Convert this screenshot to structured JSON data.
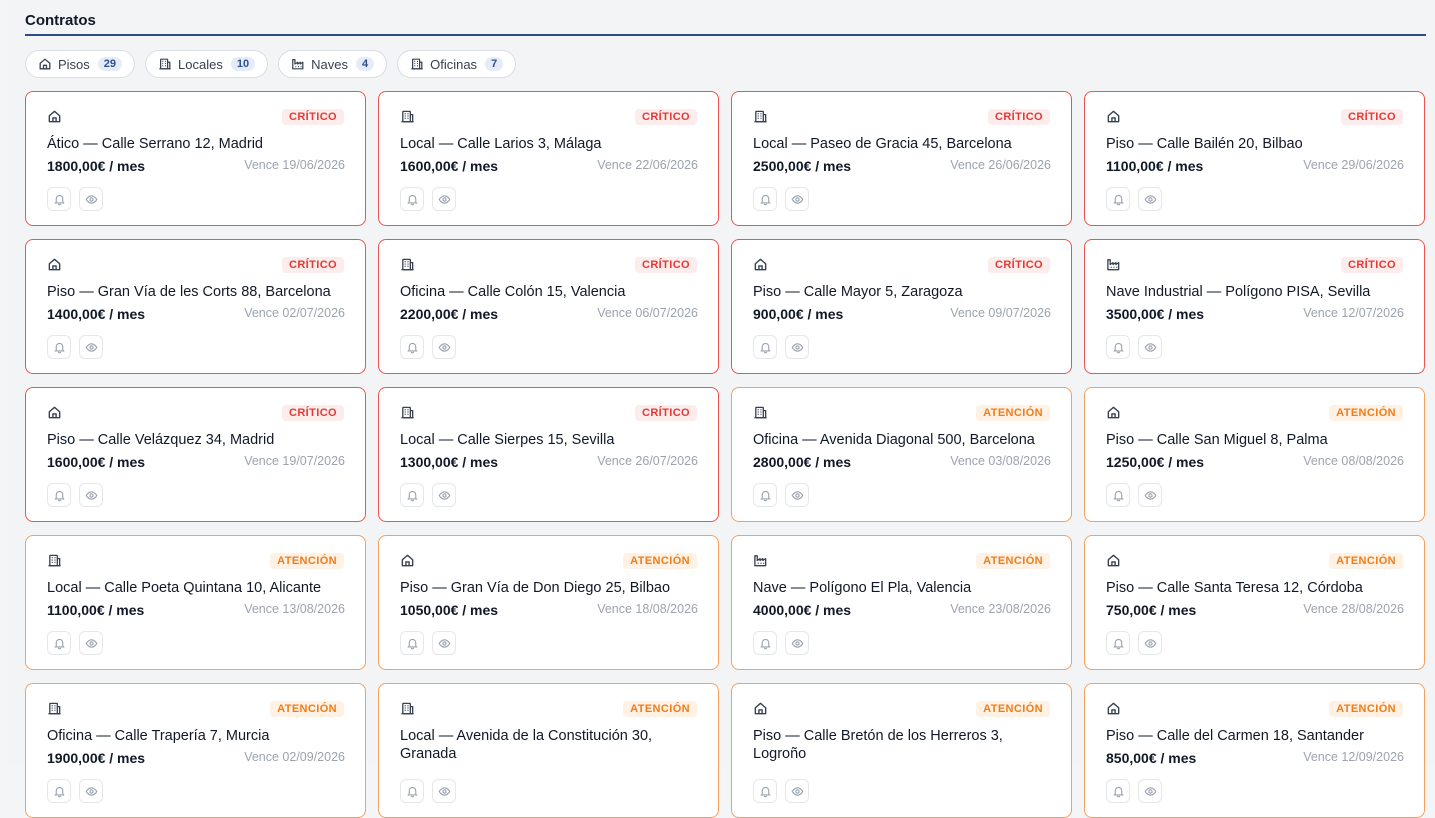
{
  "section": {
    "title": "Contratos"
  },
  "tabs": [
    {
      "icon": "house-icon",
      "label": "Pisos",
      "count": "29"
    },
    {
      "icon": "building-icon",
      "label": "Locales",
      "count": "10"
    },
    {
      "icon": "factory-icon",
      "label": "Naves",
      "count": "4"
    },
    {
      "icon": "building-icon",
      "label": "Oficinas",
      "count": "7"
    }
  ],
  "colors": {
    "critical": "#e53935",
    "attention": "#ef7d1a",
    "accent": "#2f4a8a"
  },
  "cards": [
    {
      "icon": "house-icon",
      "status": "critical",
      "badge": "CRÍTICO",
      "title": "Ático — Calle Serrano 12, Madrid",
      "price": "1800,00€ / mes",
      "due": "Vence 19/06/2026"
    },
    {
      "icon": "building-icon",
      "status": "critical",
      "badge": "CRÍTICO",
      "title": "Local — Calle Larios 3, Málaga",
      "price": "1600,00€ / mes",
      "due": "Vence 22/06/2026"
    },
    {
      "icon": "building-icon",
      "status": "critical",
      "badge": "CRÍTICO",
      "title": "Local — Paseo de Gracia 45, Barcelona",
      "price": "2500,00€ / mes",
      "due": "Vence 26/06/2026"
    },
    {
      "icon": "house-icon",
      "status": "critical",
      "badge": "CRÍTICO",
      "title": "Piso — Calle Bailén 20, Bilbao",
      "price": "1100,00€ / mes",
      "due": "Vence 29/06/2026"
    },
    {
      "icon": "house-icon",
      "status": "critical",
      "badge": "CRÍTICO",
      "title": "Piso — Gran Vía de les Corts 88, Barcelona",
      "price": "1400,00€ / mes",
      "due": "Vence 02/07/2026"
    },
    {
      "icon": "building-icon",
      "status": "critical",
      "badge": "CRÍTICO",
      "title": "Oficina — Calle Colón 15, Valencia",
      "price": "2200,00€ / mes",
      "due": "Vence 06/07/2026"
    },
    {
      "icon": "house-icon",
      "status": "critical",
      "badge": "CRÍTICO",
      "title": "Piso — Calle Mayor 5, Zaragoza",
      "price": "900,00€ / mes",
      "due": "Vence 09/07/2026"
    },
    {
      "icon": "factory-icon",
      "status": "critical",
      "badge": "CRÍTICO",
      "title": "Nave Industrial — Polígono PISA, Sevilla",
      "price": "3500,00€ / mes",
      "due": "Vence 12/07/2026"
    },
    {
      "icon": "house-icon",
      "status": "critical",
      "badge": "CRÍTICO",
      "title": "Piso — Calle Velázquez 34, Madrid",
      "price": "1600,00€ / mes",
      "due": "Vence 19/07/2026"
    },
    {
      "icon": "building-icon",
      "status": "critical",
      "badge": "CRÍTICO",
      "title": "Local — Calle Sierpes 15, Sevilla",
      "price": "1300,00€ / mes",
      "due": "Vence 26/07/2026"
    },
    {
      "icon": "building-icon",
      "status": "attention",
      "badge": "ATENCIÓN",
      "title": "Oficina — Avenida Diagonal 500, Barcelona",
      "price": "2800,00€ / mes",
      "due": "Vence 03/08/2026"
    },
    {
      "icon": "house-icon",
      "status": "attention",
      "badge": "ATENCIÓN",
      "title": "Piso — Calle San Miguel 8, Palma",
      "price": "1250,00€ / mes",
      "due": "Vence 08/08/2026"
    },
    {
      "icon": "building-icon",
      "status": "attention",
      "badge": "ATENCIÓN",
      "title": "Local — Calle Poeta Quintana 10, Alicante",
      "price": "1100,00€ / mes",
      "due": "Vence 13/08/2026"
    },
    {
      "icon": "house-icon",
      "status": "attention",
      "badge": "ATENCIÓN",
      "title": "Piso — Gran Vía de Don Diego 25, Bilbao",
      "price": "1050,00€ / mes",
      "due": "Vence 18/08/2026"
    },
    {
      "icon": "factory-icon",
      "status": "attention",
      "badge": "ATENCIÓN",
      "title": "Nave — Polígono El Pla, Valencia",
      "price": "4000,00€ / mes",
      "due": "Vence 23/08/2026"
    },
    {
      "icon": "house-icon",
      "status": "attention",
      "badge": "ATENCIÓN",
      "title": "Piso — Calle Santa Teresa 12, Córdoba",
      "price": "750,00€ / mes",
      "due": "Vence 28/08/2026"
    },
    {
      "icon": "building-icon",
      "status": "attention",
      "badge": "ATENCIÓN",
      "title": "Oficina — Calle Trapería 7, Murcia",
      "price": "1900,00€ / mes",
      "due": "Vence 02/09/2026"
    },
    {
      "icon": "building-icon",
      "status": "attention",
      "badge": "ATENCIÓN",
      "title": "Local — Avenida de la Constitución 30, Granada",
      "price": "",
      "due": ""
    },
    {
      "icon": "house-icon",
      "status": "attention",
      "badge": "ATENCIÓN",
      "title": "Piso — Calle Bretón de los Herreros 3, Logroño",
      "price": "",
      "due": ""
    },
    {
      "icon": "house-icon",
      "status": "attention",
      "badge": "ATENCIÓN",
      "title": "Piso — Calle del Carmen 18, Santander",
      "price": "850,00€ / mes",
      "due": "Vence 12/09/2026"
    }
  ]
}
